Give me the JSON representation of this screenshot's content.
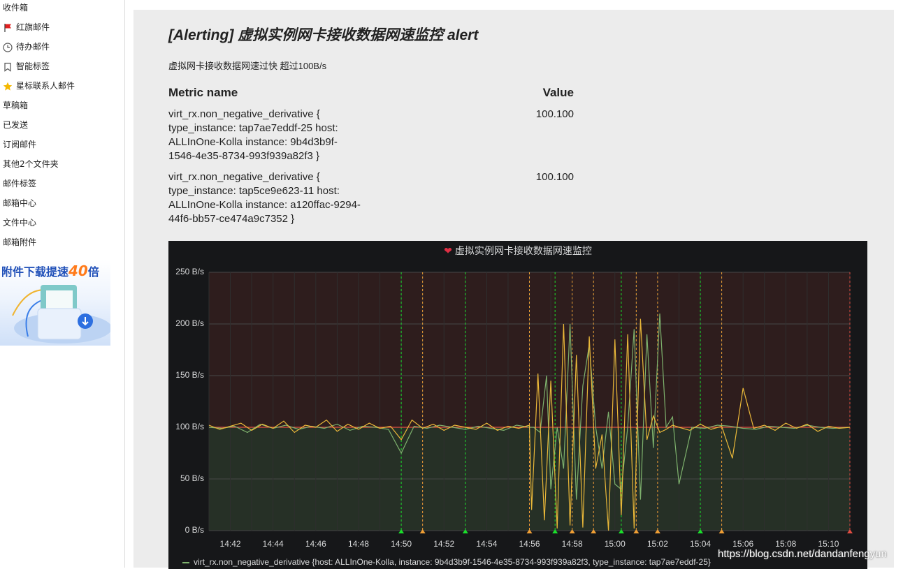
{
  "sidebar": {
    "items": [
      {
        "label": "收件箱",
        "icon": ""
      },
      {
        "label": "红旗邮件",
        "icon": "red-flag-icon"
      },
      {
        "label": "待办邮件",
        "icon": "clock-icon"
      },
      {
        "label": "智能标签",
        "icon": "bookmark-icon"
      },
      {
        "label": "星标联系人邮件",
        "icon": "star-icon"
      },
      {
        "label": "草稿箱",
        "icon": ""
      },
      {
        "label": "已发送",
        "icon": ""
      },
      {
        "label": "订阅邮件",
        "icon": ""
      },
      {
        "label": "其他2个文件夹",
        "icon": ""
      },
      {
        "label": "邮件标签",
        "icon": ""
      },
      {
        "label": "邮箱中心",
        "icon": ""
      },
      {
        "label": "文件中心",
        "icon": ""
      },
      {
        "label": "邮箱附件",
        "icon": ""
      }
    ],
    "promo": {
      "text": "附件下载提速",
      "number": "40",
      "suffix": "倍"
    }
  },
  "email": {
    "title": "[Alerting] 虚拟实例网卡接收数据网速监控 alert",
    "message": "虚拟网卡接收数据网速过快 超过100B/s",
    "table": {
      "col_metric": "Metric name",
      "col_value": "Value",
      "rows": [
        {
          "metric": "virt_rx.non_negative_derivative { type_instance: tap7ae7eddf-25 host: ALLInOne-Kolla instance: 9b4d3b9f-1546-4e35-8734-993f939a82f3 }",
          "value": "100.100"
        },
        {
          "metric": "virt_rx.non_negative_derivative { type_instance: tap5ce9e623-11 host: ALLInOne-Kolla instance: a120ffac-9294-44f6-bb57-ce474a9c7352 }",
          "value": "100.100"
        }
      ]
    }
  },
  "panel": {
    "title": "虚拟实例网卡接收数据网速监控",
    "legend": "virt_rx.non_negative_derivative {host: ALLInOne-Kolla, instance: 9b4d3b9f-1546-4e35-8734-993f939a82f3, type_instance: tap7ae7eddf-25}",
    "threshold": 100,
    "colors": {
      "bg": "#161719",
      "series1": "#7eb26d",
      "series2": "#eab839",
      "threshold": "#e24d42",
      "ok": "#1ae02b",
      "pending": "#f09f35"
    }
  },
  "chart_data": {
    "type": "line",
    "title": "虚拟实例网卡接收数据网速监控",
    "ylim": [
      0,
      250
    ],
    "y_ticks": [
      "0 B/s",
      "50 B/s",
      "100 B/s",
      "150 B/s",
      "200 B/s",
      "250 B/s"
    ],
    "x_ticks": [
      "14:42",
      "14:44",
      "14:46",
      "14:48",
      "14:50",
      "14:52",
      "14:54",
      "14:56",
      "14:58",
      "15:00",
      "15:02",
      "15:04",
      "15:06",
      "15:08",
      "15:10"
    ],
    "grid": true,
    "xrange_minutes": [
      0,
      30
    ],
    "threshold": 100,
    "ok_annotations_minutes": [
      9.0,
      12.0,
      16.2,
      19.3,
      23.0
    ],
    "pending_annotations_minutes": [
      10.0,
      15.0,
      17.0,
      18.0,
      20.0,
      21.0,
      24.0
    ],
    "alert_annotation_minutes": [
      30.0
    ],
    "series": [
      {
        "name": "virt_rx.non_negative_derivative {host: ALLInOne-Kolla, instance: 9b4d3b9f-1546-4e35-8734-993f939a82f3, type_instance: tap7ae7eddf-25}",
        "x": [
          0,
          0.6,
          1.2,
          1.8,
          2.4,
          3.0,
          3.6,
          4.2,
          4.8,
          5.4,
          6.0,
          6.6,
          7.2,
          7.8,
          8.4,
          9.0,
          9.6,
          10.2,
          10.8,
          11.4,
          12.0,
          12.6,
          13.2,
          13.8,
          14.4,
          15.0,
          15.2,
          15.5,
          15.8,
          16.0,
          16.3,
          16.6,
          16.9,
          17.2,
          17.5,
          17.8,
          18.1,
          18.4,
          18.7,
          19.0,
          19.3,
          19.6,
          19.9,
          20.2,
          20.5,
          20.8,
          21.1,
          21.4,
          21.7,
          22.0,
          22.6,
          23.2,
          23.8,
          24.4,
          25.0,
          25.6,
          26.2,
          26.8,
          27.4,
          28.0,
          28.6,
          29.2,
          30.0
        ],
        "values": [
          100,
          99,
          101,
          95,
          103,
          99,
          102,
          98,
          101,
          99,
          103,
          97,
          101,
          100,
          98,
          75,
          101,
          99,
          102,
          100,
          98,
          101,
          99,
          97,
          102,
          100,
          100,
          95,
          150,
          40,
          100,
          60,
          200,
          30,
          140,
          180,
          100,
          60,
          115,
          45,
          40,
          100,
          195,
          30,
          190,
          80,
          210,
          100,
          110,
          45,
          100,
          99,
          102,
          101,
          99,
          98,
          101,
          100,
          99,
          102,
          100,
          99,
          100
        ]
      },
      {
        "name": "virt_rx.non_negative_derivative {host: ALLInOne-Kolla, instance: a120ffac-9294-44f6-bb57-ce474a9c7352, type_instance: tap5ce9e623-11}",
        "x": [
          0,
          0.5,
          1.0,
          1.5,
          2.0,
          2.5,
          3.0,
          3.5,
          4.0,
          4.5,
          5.0,
          5.5,
          6.0,
          6.5,
          7.0,
          7.5,
          8.0,
          8.5,
          9.0,
          9.5,
          10.0,
          10.5,
          11.0,
          11.5,
          12.0,
          12.5,
          13.0,
          13.5,
          14.0,
          14.5,
          15.0,
          15.1,
          15.4,
          15.7,
          16.0,
          16.3,
          16.6,
          16.9,
          17.2,
          17.5,
          17.8,
          18.1,
          18.4,
          18.7,
          19.0,
          19.3,
          19.6,
          19.9,
          20.2,
          20.5,
          20.8,
          21.1,
          21.4,
          21.7,
          22.0,
          22.5,
          23.0,
          23.5,
          24.0,
          24.5,
          25.0,
          25.5,
          26.0,
          26.5,
          27.0,
          27.5,
          28.0,
          28.5,
          29.0,
          29.5,
          30.0
        ],
        "values": [
          102,
          98,
          101,
          104,
          97,
          103,
          99,
          106,
          95,
          102,
          100,
          107,
          96,
          103,
          98,
          104,
          99,
          101,
          88,
          107,
          99,
          103,
          97,
          102,
          100,
          98,
          104,
          97,
          101,
          99,
          102,
          20,
          152,
          10,
          145,
          2,
          200,
          5,
          170,
          3,
          188,
          60,
          93,
          0,
          185,
          15,
          190,
          2,
          205,
          88,
          111,
          95,
          98,
          102,
          100,
          97,
          103,
          98,
          101,
          70,
          138,
          99,
          102,
          97,
          104,
          99,
          103,
          96,
          101,
          99,
          100
        ]
      }
    ]
  }
}
